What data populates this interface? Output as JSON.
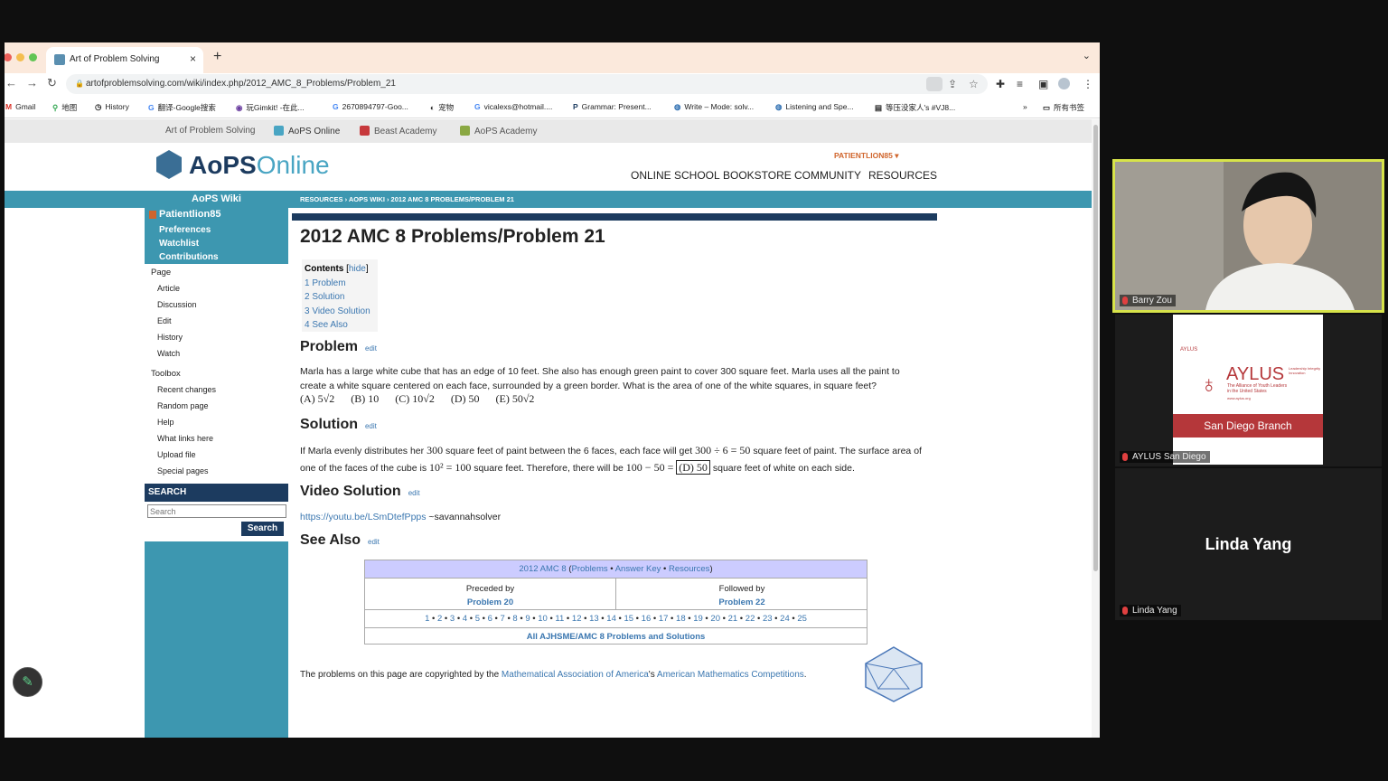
{
  "browser": {
    "tab_title": "Art of Problem Solving",
    "tab_close": "×",
    "new_tab": "+",
    "tab_dropdown": "⌄",
    "url": "artofproblemsolving.com/wiki/index.php/2012_AMC_8_Problems/Problem_21",
    "bookmarks": [
      "Gmail",
      "地图",
      "History",
      "翻译-Google搜索",
      "玩Gimkit! -在此...",
      "2670894797-Goo...",
      "宠物",
      "vicalexs@hotmail....",
      "Grammar: Present...",
      "Write – Mode: solv...",
      "Listening and Spe...",
      "等压没家人's #VJ8...",
      "»",
      "所有书签"
    ]
  },
  "sitebar": {
    "items": [
      "Art of Problem Solving",
      "AoPS Online",
      "Beast Academy",
      "AoPS Academy"
    ]
  },
  "header": {
    "logo_main": "AoPS",
    "logo_sub": "Online",
    "user": "PATIENTLION85 ▾",
    "nav": [
      "ONLINE SCHOOL",
      "BOOKSTORE",
      "COMMUNITY",
      "RESOURCES"
    ]
  },
  "breadcrumb": "RESOURCES › AOPS WIKI › 2012 AMC 8 PROBLEMS/PROBLEM 21",
  "sidebar": {
    "title": "AoPS Wiki",
    "username": "Patientlion85",
    "user_links": [
      "Preferences",
      "Watchlist",
      "Contributions"
    ],
    "page_heading": "Page",
    "page_links": [
      "Article",
      "Discussion",
      "Edit",
      "History",
      "Watch"
    ],
    "toolbox_heading": "Toolbox",
    "toolbox_links": [
      "Recent changes",
      "Random page",
      "Help",
      "What links here",
      "Upload file",
      "Special pages"
    ],
    "search_heading": "SEARCH",
    "search_placeholder": "Search",
    "search_button": "Search"
  },
  "article": {
    "title": "2012 AMC 8 Problems/Problem 21",
    "toc_title": "Contents",
    "toc_hide": "hide",
    "toc": [
      "1 Problem",
      "2 Solution",
      "3 Video Solution",
      "4 See Also"
    ],
    "edit_label": "edit",
    "problem_heading": "Problem",
    "problem_text": "Marla has a large white cube that has an edge of 10 feet. She also has enough green paint to cover 300 square feet. Marla uses all the paint to create a white square centered on each face, surrounded by a green border. What is the area of one of the white squares, in square feet?",
    "choices": [
      "(A) 5√2",
      "(B) 10",
      "(C) 10√2",
      "(D) 50",
      "(E) 50√2"
    ],
    "solution_heading": "Solution",
    "solution_parts": {
      "a": "If Marla evenly distributes her ",
      "b": "300",
      "c": " square feet of paint between the 6 faces, each face will get ",
      "d": "300 ÷ 6 = 50",
      "e": " square feet of paint. The surface area of one of the faces of the cube is ",
      "f": "10² = 100",
      "g": " square feet. Therefore, there will be ",
      "h": "100 − 50 =",
      "i": "(D) 50",
      "j": " square feet of white on each side."
    },
    "video_heading": "Video Solution",
    "video_link": "https://youtu.be/LSmDtefPpps",
    "video_author": " ~savannahsolver",
    "see_also_heading": "See Also",
    "nav_table": {
      "title": "2012 AMC 8",
      "title_links": [
        "Problems",
        "Answer Key",
        "Resources"
      ],
      "preceded_label": "Preceded by",
      "preceded": "Problem 20",
      "followed_label": "Followed by",
      "followed": "Problem 22",
      "numbers": [
        "1",
        "2",
        "3",
        "4",
        "5",
        "6",
        "7",
        "8",
        "9",
        "10",
        "11",
        "12",
        "13",
        "14",
        "15",
        "16",
        "17",
        "18",
        "19",
        "20",
        "21",
        "22",
        "23",
        "24",
        "25"
      ],
      "all_link": "All AJHSME/AMC 8 Problems and Solutions"
    },
    "copyright_a": "The problems on this page are copyrighted by the ",
    "copyright_link1": "Mathematical Association of America",
    "copyright_b": "'s ",
    "copyright_link2": "American Mathematics Competitions",
    "copyright_c": "."
  },
  "video": {
    "tiles": [
      {
        "name": "Barry Zou"
      },
      {
        "name": "AYLUS San Diego"
      },
      {
        "name": "Linda Yang"
      }
    ],
    "aylus_logo": "AYLUS",
    "aylus_small": "AYLUS",
    "aylus_tagline": "The Alliance of Youth Leaders in the United States",
    "aylus_side": "Leadership Integrity Innovation",
    "aylus_url": "www.aylus.org",
    "aylus_branch": "San Diego Branch",
    "big_name": "Linda Yang"
  },
  "colors": {
    "accent": "#3d97b0",
    "navy": "#1c3b5f",
    "link": "#3b77b0",
    "speaker_border": "#d7e34a",
    "aylus_red": "#b5373a"
  }
}
